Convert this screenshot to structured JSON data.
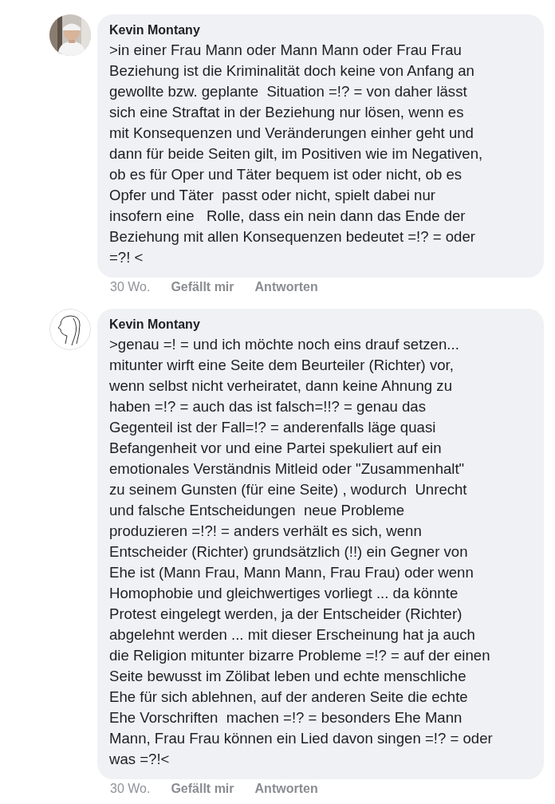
{
  "comments": [
    {
      "author": "Kevin Montany",
      "text": ">in einer Frau Mann oder Mann Mann oder Frau Frau\nBeziehung ist die Kriminalität doch keine von Anfang an\ngewollte bzw. geplante  Situation =!? = von daher lässt\nsich eine Straftat in der Beziehung nur lösen, wenn es\nmit Konsequenzen und Veränderungen einher geht und\ndann für beide Seiten gilt, im Positiven wie im Negativen,\nob es für Oper und Täter bequem ist oder nicht, ob es\nOpfer und Täter  passt oder nicht, spielt dabei nur\ninsofern eine   Rolle, dass ein nein dann das Ende der\nBeziehung mit allen Konsequenzen bedeutet =!? = oder\n=?! <",
      "time": "30 Wo.",
      "like": "Gefällt mir",
      "reply": "Antworten"
    },
    {
      "avatar": {
        "kind": "drawing"
      },
      "author": "Kevin Montany",
      "text": ">genau =! = und ich möchte noch eins drauf setzen...\nmitunter wirft eine Seite dem Beurteiler (Richter) vor,\nwenn selbst nicht verheiratet, dann keine Ahnung zu\nhaben =!? = auch das ist falsch=!!? = genau das\nGegenteil ist der Fall=!? = anderenfalls läge quasi\nBefangenheit vor und eine Partei spekuliert auf ein\nemotionales Verständnis Mitleid oder \"Zusammenhalt\"\nzu seinem Gunsten (für eine Seite) , wodurch  Unrecht\nund falsche Entscheidungen  neue Probleme\nproduzieren =!?! = anders verhält es sich, wenn\nEntscheider (Richter) grundsätzlich (!!) ein Gegner von\nEhe ist (Mann Frau, Mann Mann, Frau Frau) oder wenn\nHomophobie und gleichwertiges vorliegt ... da könnte\nProtest eingelegt werden, ja der Entscheider (Richter)\nabgelehnt werden ... mit dieser Erscheinung hat ja auch\ndie Religion mitunter bizarre Probleme =!? = auf der einen\nSeite bewusst im Zölibat leben und echte menschliche\nEhe für sich ablehnen, auf der anderen Seite die echte\nEhe Vorschriften  machen =!? = besonders Ehe Mann\nMann, Frau Frau können ein Lied davon singen =!? = oder\nwas =?!<",
      "time": "30 Wo.",
      "like": "Gefällt mir",
      "reply": "Antworten"
    }
  ]
}
